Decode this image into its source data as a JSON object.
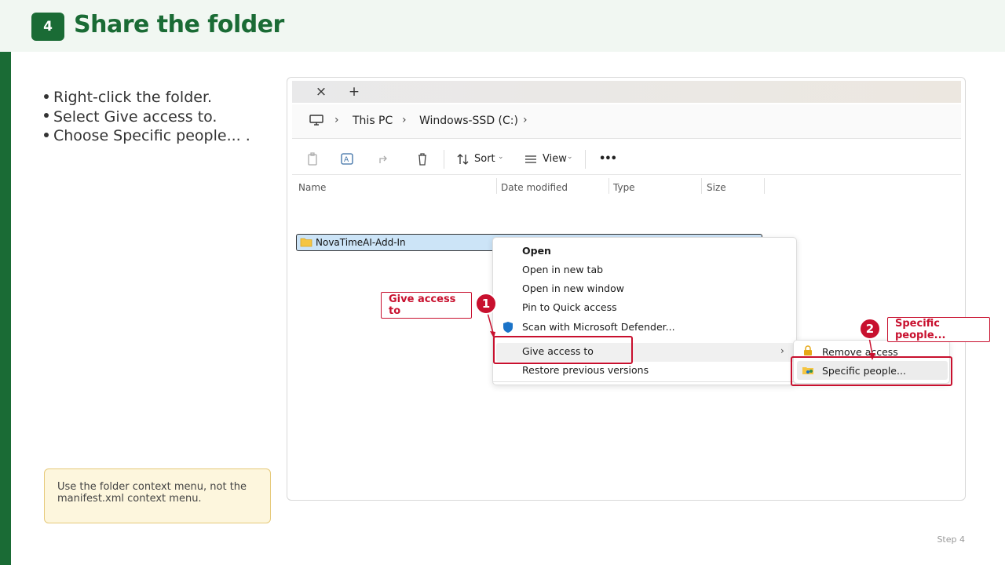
{
  "header": {
    "step_number": "4",
    "title": "Share the folder"
  },
  "instructions": [
    "Right-click the folder.",
    "Select Give access to.",
    "Choose Specific people... ."
  ],
  "note": "Use the folder context menu, not the manifest.xml context menu.",
  "footer": "Step 4",
  "explorer": {
    "tab_close": "×",
    "tab_new": "+",
    "breadcrumb": [
      "This PC",
      "Windows-SSD (C:)"
    ],
    "toolbar": {
      "sort_label": "Sort",
      "view_label": "View",
      "more_label": "•••"
    },
    "columns": [
      "Name",
      "Date modified",
      "Type",
      "Size"
    ],
    "folder_name": "NovaTimeAI-Add-In",
    "context_menu": [
      "Open",
      "Open in new tab",
      "Open in new window",
      "Pin to Quick access",
      "Scan with Microsoft Defender...",
      "Give access to",
      "Restore previous versions"
    ],
    "submenu": [
      "Remove access",
      "Specific people..."
    ]
  },
  "callouts": {
    "one_number": "1",
    "one_label": "Give access to",
    "two_number": "2",
    "two_label": "Specific people..."
  },
  "colors": {
    "brand_green": "#1a6b35",
    "callout_red": "#c8102e",
    "selection_blue": "#cce4f7",
    "note_bg": "#fdf6dd"
  }
}
